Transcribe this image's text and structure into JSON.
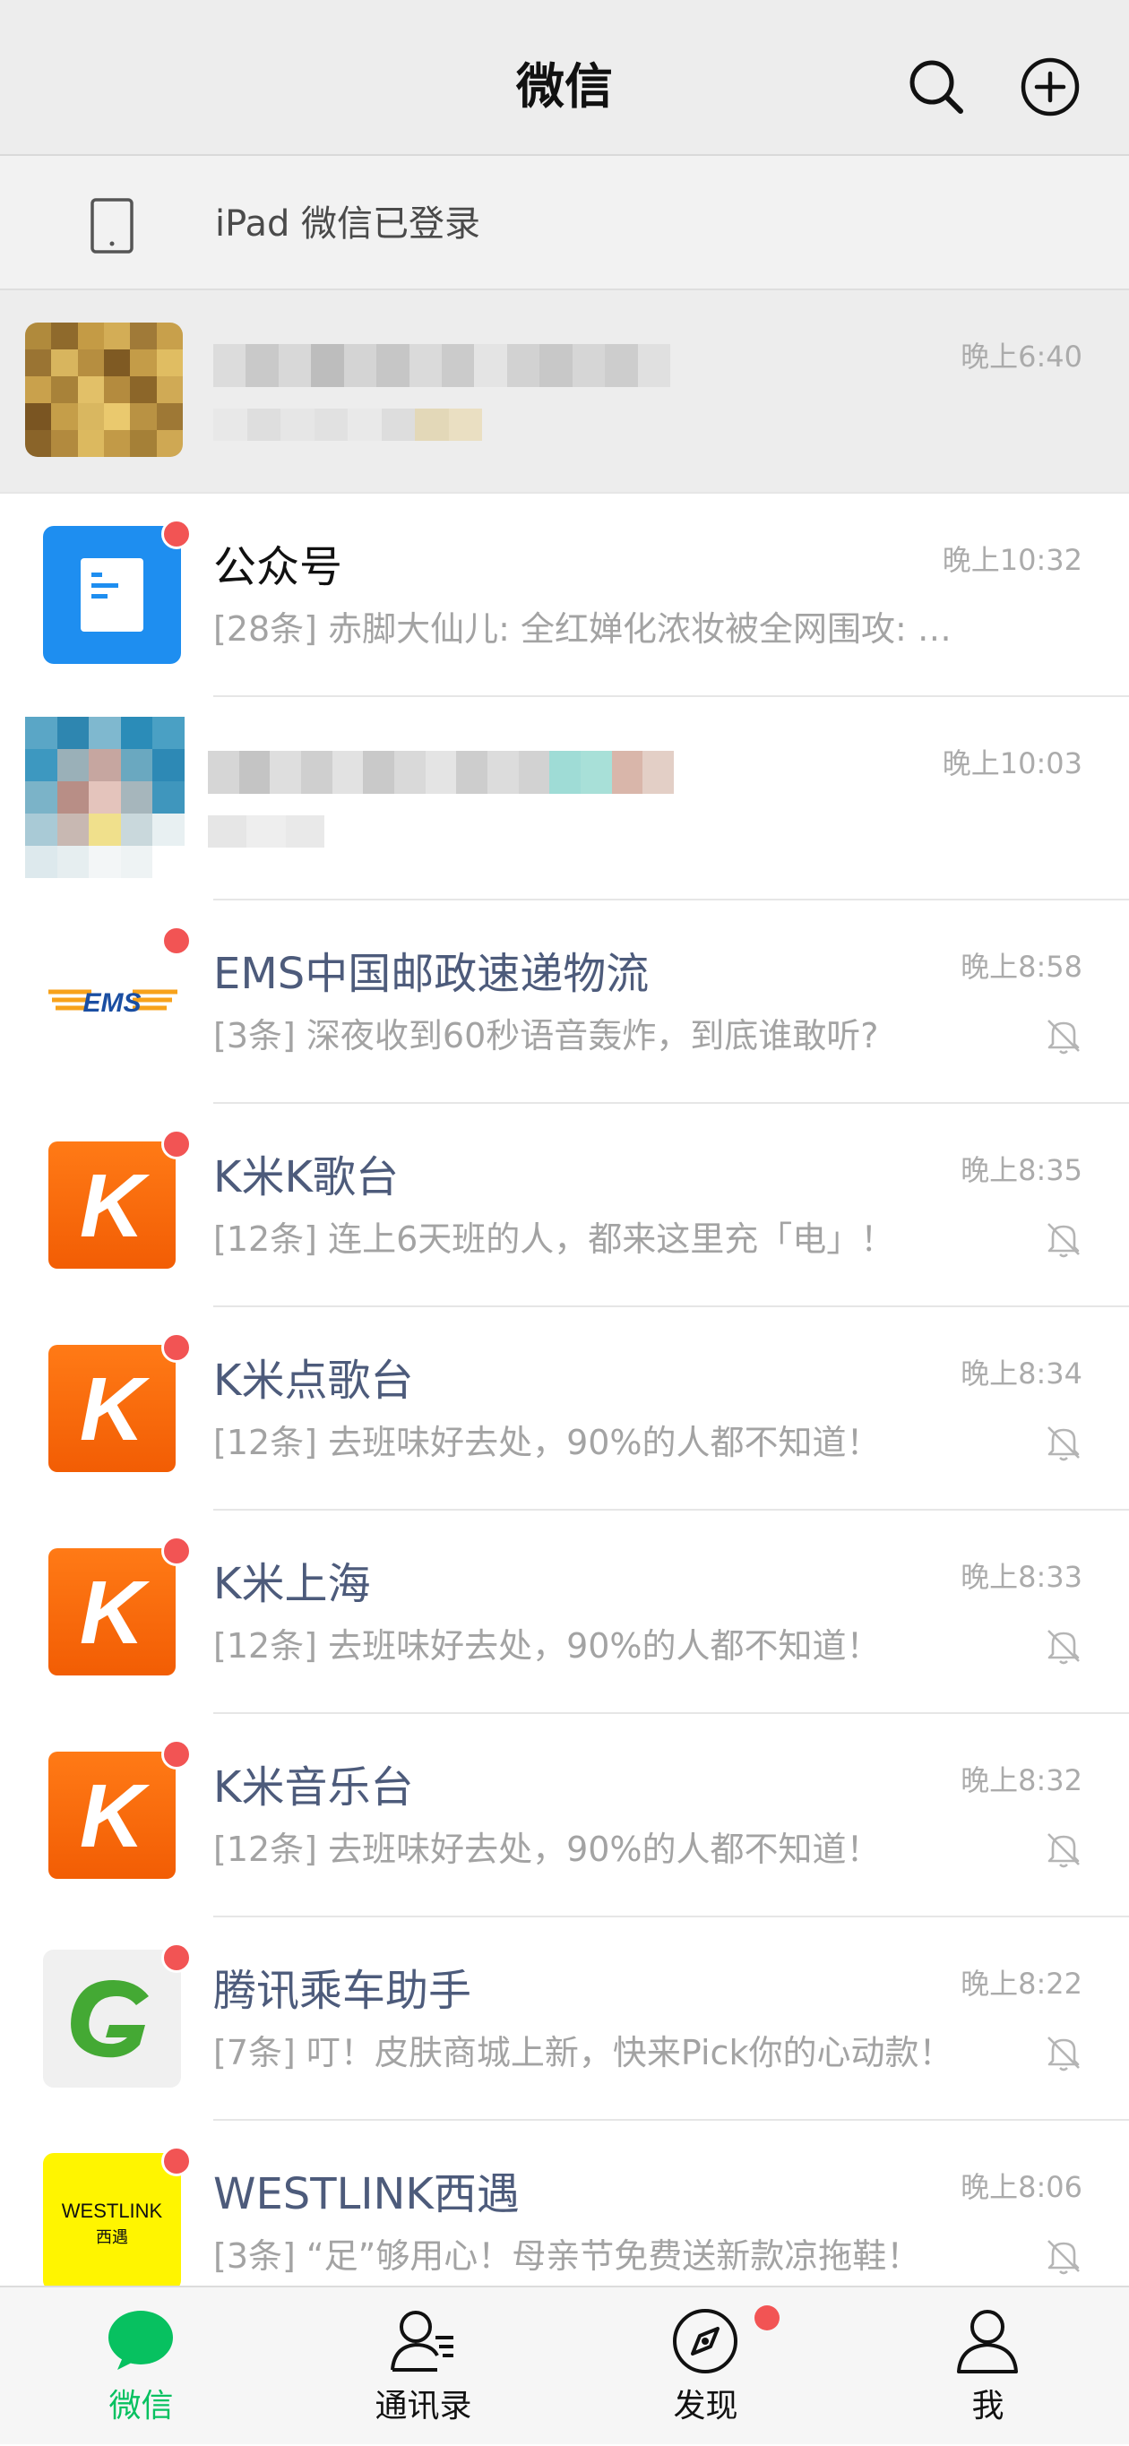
{
  "header": {
    "title": "微信",
    "icons": [
      "search-icon",
      "add-circle-icon"
    ]
  },
  "device_banner": {
    "text": "iPad 微信已登录",
    "icon": "tablet-icon"
  },
  "chats": [
    {
      "id": "pinned-contact",
      "name": "",
      "preview": "",
      "time": "晚上6:40",
      "pinned": true,
      "blurred": true,
      "unread_dot": false,
      "muted": false
    },
    {
      "id": "public-accounts",
      "name": "公众号",
      "preview": "[28条] 赤脚大仙儿: 全红婵化浓妆被全网围攻: …",
      "time": "晚上10:32",
      "unread_dot": true,
      "muted": false
    },
    {
      "id": "blurred-contact",
      "name": "",
      "preview": "",
      "time": "晚上10:03",
      "blurred": true,
      "unread_dot": false,
      "muted": false
    },
    {
      "id": "ems",
      "name": "EMS中国邮政速递物流",
      "preview": "[3条] 深夜收到60秒语音轰炸，到底谁敢听?",
      "time": "晚上8:58",
      "unread_dot": true,
      "muted": true
    },
    {
      "id": "kmik-karaoke",
      "name": "K米K歌台",
      "preview": "[12条] 连上6天班的人，都来这里充「电」！",
      "time": "晚上8:35",
      "unread_dot": true,
      "muted": true
    },
    {
      "id": "kmi-diange",
      "name": "K米点歌台",
      "preview": "[12条] 去班味好去处，90%的人都不知道！",
      "time": "晚上8:34",
      "unread_dot": true,
      "muted": true
    },
    {
      "id": "kmi-shanghai",
      "name": "K米上海",
      "preview": "[12条] 去班味好去处，90%的人都不知道！",
      "time": "晚上8:33",
      "unread_dot": true,
      "muted": true
    },
    {
      "id": "kmi-music",
      "name": "K米音乐台",
      "preview": "[12条] 去班味好去处，90%的人都不知道！",
      "time": "晚上8:32",
      "unread_dot": true,
      "muted": true
    },
    {
      "id": "tencent-ride",
      "name": "腾讯乘车助手",
      "preview": "[7条] 叮！皮肤商城上新，快来Pick你的心动款！",
      "time": "晚上8:22",
      "unread_dot": true,
      "muted": true
    },
    {
      "id": "westlink",
      "name": "WESTLINK西遇",
      "preview": "[3条] “足”够用心！母亲节免费送新款凉拖鞋！",
      "time": "晚上8:06",
      "unread_dot": true,
      "muted": true
    }
  ],
  "logos": {
    "ems": "EMS",
    "k": "K",
    "westlink_top": "WESTLINK",
    "westlink_bottom": "西遇"
  },
  "tabs": [
    {
      "label": "微信",
      "icon": "chat-bubble-icon",
      "active": true
    },
    {
      "label": "通讯录",
      "icon": "contacts-icon",
      "active": false
    },
    {
      "label": "发现",
      "icon": "compass-icon",
      "active": false,
      "dot": true
    },
    {
      "label": "我",
      "icon": "profile-icon",
      "active": false
    }
  ],
  "colors": {
    "brand_green": "#07c160",
    "unread_red": "#f25454",
    "service_name": "#4d5b7b"
  }
}
